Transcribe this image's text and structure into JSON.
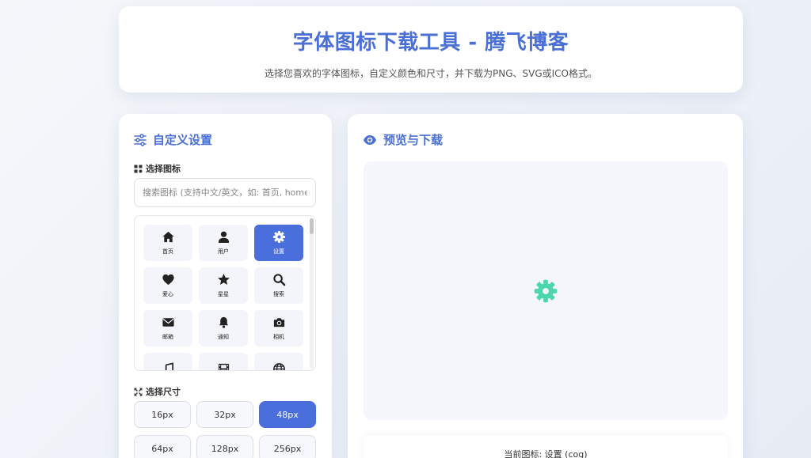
{
  "header": {
    "title": "字体图标下载工具 - 腾飞博客",
    "subtitle": "选择您喜欢的字体图标，自定义颜色和尺寸，并下载为PNG、SVG或ICO格式。"
  },
  "settings": {
    "title": "自定义设置",
    "title_icon": "sliders-icon",
    "icon_section_label": "选择图标",
    "search_placeholder": "搜索图标 (支持中文/英文，如: 首页, home, u",
    "icons": [
      {
        "name": "home-icon",
        "label": "首页",
        "selected": false
      },
      {
        "name": "user-icon",
        "label": "用户",
        "selected": false
      },
      {
        "name": "cog-icon",
        "label": "设置",
        "selected": true
      },
      {
        "name": "heart-icon",
        "label": "爱心",
        "selected": false
      },
      {
        "name": "star-icon",
        "label": "星星",
        "selected": false
      },
      {
        "name": "search-icon",
        "label": "搜索",
        "selected": false
      },
      {
        "name": "envelope-icon",
        "label": "邮箱",
        "selected": false
      },
      {
        "name": "bell-icon",
        "label": "通知",
        "selected": false
      },
      {
        "name": "camera-icon",
        "label": "相机",
        "selected": false
      },
      {
        "name": "music-icon",
        "label": "",
        "selected": false
      },
      {
        "name": "film-icon",
        "label": "",
        "selected": false
      },
      {
        "name": "globe-icon",
        "label": "",
        "selected": false
      }
    ],
    "size_section_label": "选择尺寸",
    "sizes": [
      {
        "label": "16px",
        "selected": false
      },
      {
        "label": "32px",
        "selected": false
      },
      {
        "label": "48px",
        "selected": true
      },
      {
        "label": "64px",
        "selected": false
      },
      {
        "label": "128px",
        "selected": false
      },
      {
        "label": "256px",
        "selected": false
      }
    ]
  },
  "preview": {
    "title": "预览与下载",
    "title_icon": "eye-icon",
    "preview_icon": "cog-icon",
    "preview_color": "#4cd6ae",
    "current_icon_text": "当前图标: 设置 (cog)"
  },
  "colors": {
    "accent": "#4a70d6",
    "selected_bg": "#4a6fdc",
    "preview_icon": "#4cd6ae"
  }
}
